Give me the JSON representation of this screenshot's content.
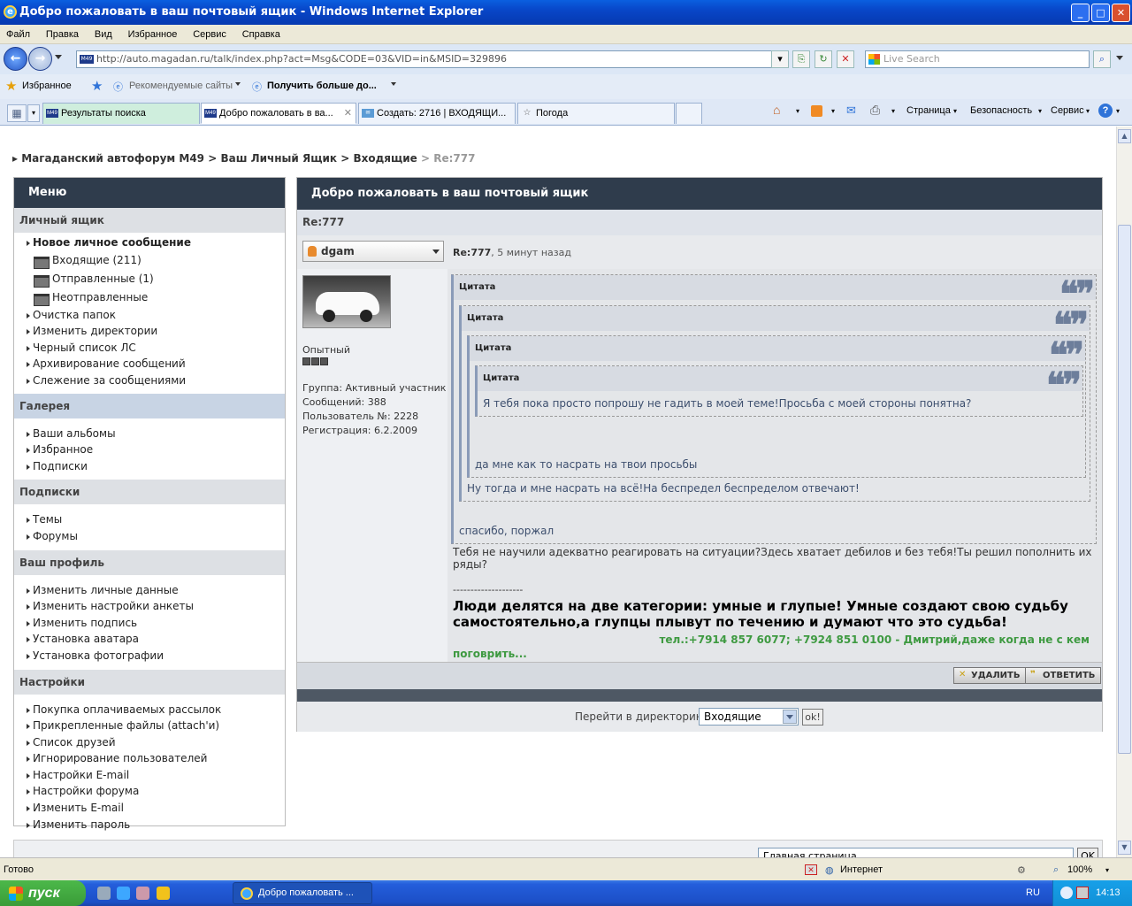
{
  "window": {
    "title": "Добро пожаловать в ваш почтовый ящик - Windows Internet Explorer"
  },
  "menu": [
    "Файл",
    "Правка",
    "Вид",
    "Избранное",
    "Сервис",
    "Справка"
  ],
  "address": {
    "url": "http://auto.magadan.ru/talk/index.php?act=Msg&CODE=03&VID=in&MSID=329896",
    "search_placeholder": "Live Search"
  },
  "favorites": {
    "label": "Избранное",
    "suggested": "Рекомендуемые сайты",
    "get_more": "Получить больше до..."
  },
  "tabs": [
    {
      "label": "Результаты поиска"
    },
    {
      "label": "Добро пожаловать в ва..."
    },
    {
      "label": "Создать: 2716 | ВХОДЯЩИ..."
    },
    {
      "label": "Погода"
    }
  ],
  "toolbar": {
    "page": "Страница",
    "safety": "Безопасность",
    "tools": "Сервис"
  },
  "breadcrumb": {
    "forum": "Магаданский автофорум M49",
    "box": "Ваш Личный Ящик",
    "inbox": "Входящие",
    "current": "Re:777"
  },
  "sidebar": {
    "title": "Меню",
    "mailbox_header": "Личный ящик",
    "mailbox_items": [
      "Новое личное сообщение",
      "Входящие (211)",
      "Отправленные (1)",
      "Неотправленные",
      "Очистка папок",
      "Изменить директории",
      "Черный список ЛС",
      "Архивирование сообщений",
      "Слежение за сообщениями"
    ],
    "gallery_header": "Галерея",
    "gallery_items": [
      "Ваши альбомы",
      "Избранное",
      "Подписки"
    ],
    "subs_header": "Подписки",
    "subs_items": [
      "Темы",
      "Форумы"
    ],
    "profile_header": "Ваш профиль",
    "profile_items": [
      "Изменить личные данные",
      "Изменить настройки анкеты",
      "Изменить подпись",
      "Установка аватара",
      "Установка фотографии"
    ],
    "settings_header": "Настройки",
    "settings_items": [
      "Покупка оплачиваемых рассылок",
      "Прикрепленные файлы (attach'и)",
      "Список друзей",
      "Игнорирование пользователей",
      "Настройки E-mail",
      "Настройки форума",
      "Изменить E-mail",
      "Изменить пароль"
    ]
  },
  "main": {
    "title": "Добро пожаловать в ваш почтовый ящик",
    "subject": "Re:777",
    "author": "dgam",
    "meta_subject": "Re:777",
    "meta_time": ", 5 минут назад",
    "rank": "Опытный",
    "group": "Группа: Активный участник",
    "posts": "Сообщений: 388",
    "user_no": "Пользователь №: 2228",
    "registered": "Регистрация: 6.2.2009",
    "quote_label": "Цитата",
    "q4_text": "Я тебя пока просто попрошу не гадить в моей теме!Просьба с моей стороны понятна?",
    "q3_text": "да мне как то насрать на твои просьбы",
    "q2_text": "Ну тогда и мне насрать на всё!На беспредел беспределом отвечают!",
    "q1_text": "спасибо, поржал",
    "reply": "Тебя не научили адекватно реагировать на ситуации?Здесь хватает дебилов и без тебя!Ты решил пополнить их ряды?",
    "sig_line": "--------------------",
    "sig_bold": " Люди делятся на две категории: умные и глупые! Умные создают свою судьбу самостоятельно,а глупцы плывут по течению и думают что это судьба!",
    "sig_green": "тел.:+7914 857 6077; +7924 851 0100 - Дмитрий,даже когда не с кем",
    "sig_green2": "поговрить...",
    "delete": "УДАЛИТЬ",
    "reply_btn": "ОТВЕТИТЬ",
    "jump_label": "Перейти в директорию:",
    "jump_value": "Входящие",
    "jump_ok": "ok!"
  },
  "bottom": {
    "select_value": "Главная страница",
    "ok": "OK"
  },
  "status": {
    "ready": "Готово",
    "zone": "Интернет",
    "zoom": "100%"
  },
  "taskbar": {
    "start": "пуск",
    "item": "Добро пожаловать ...",
    "lang": "RU",
    "time": "14:13"
  }
}
